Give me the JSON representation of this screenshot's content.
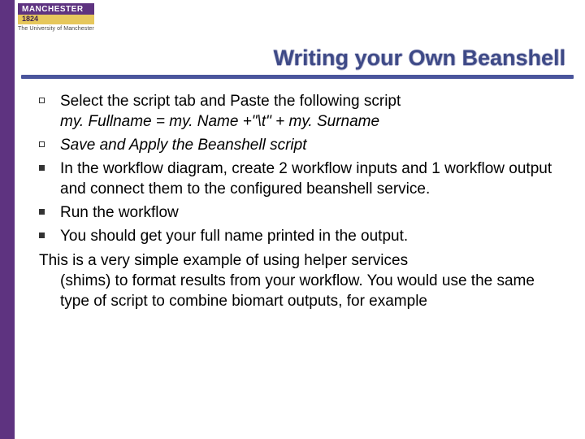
{
  "brand": {
    "name": "MANCHESTER",
    "year": "1824",
    "subline": "The University of Manchester"
  },
  "title": "Writing your Own Beanshell",
  "items": [
    {
      "marker": "square",
      "text": "Select the script tab and Paste the following script",
      "italic_line": "my. Fullname = my. Name +\"\\t\" + my. Surname"
    },
    {
      "marker": "square",
      "italic_only": "Save and Apply the Beanshell script"
    },
    {
      "marker": "filled",
      "text": "In the workflow diagram, create 2 workflow inputs and 1 workflow output and connect them to the configured beanshell service."
    },
    {
      "marker": "filled",
      "text": "Run the workflow"
    },
    {
      "marker": "filled",
      "text": "You should get your full name printed in the output."
    }
  ],
  "closing": {
    "first": "This is a very simple example of using helper services",
    "rest": "(shims) to format results from your workflow. You would use the same type of script to combine biomart outputs, for example"
  }
}
